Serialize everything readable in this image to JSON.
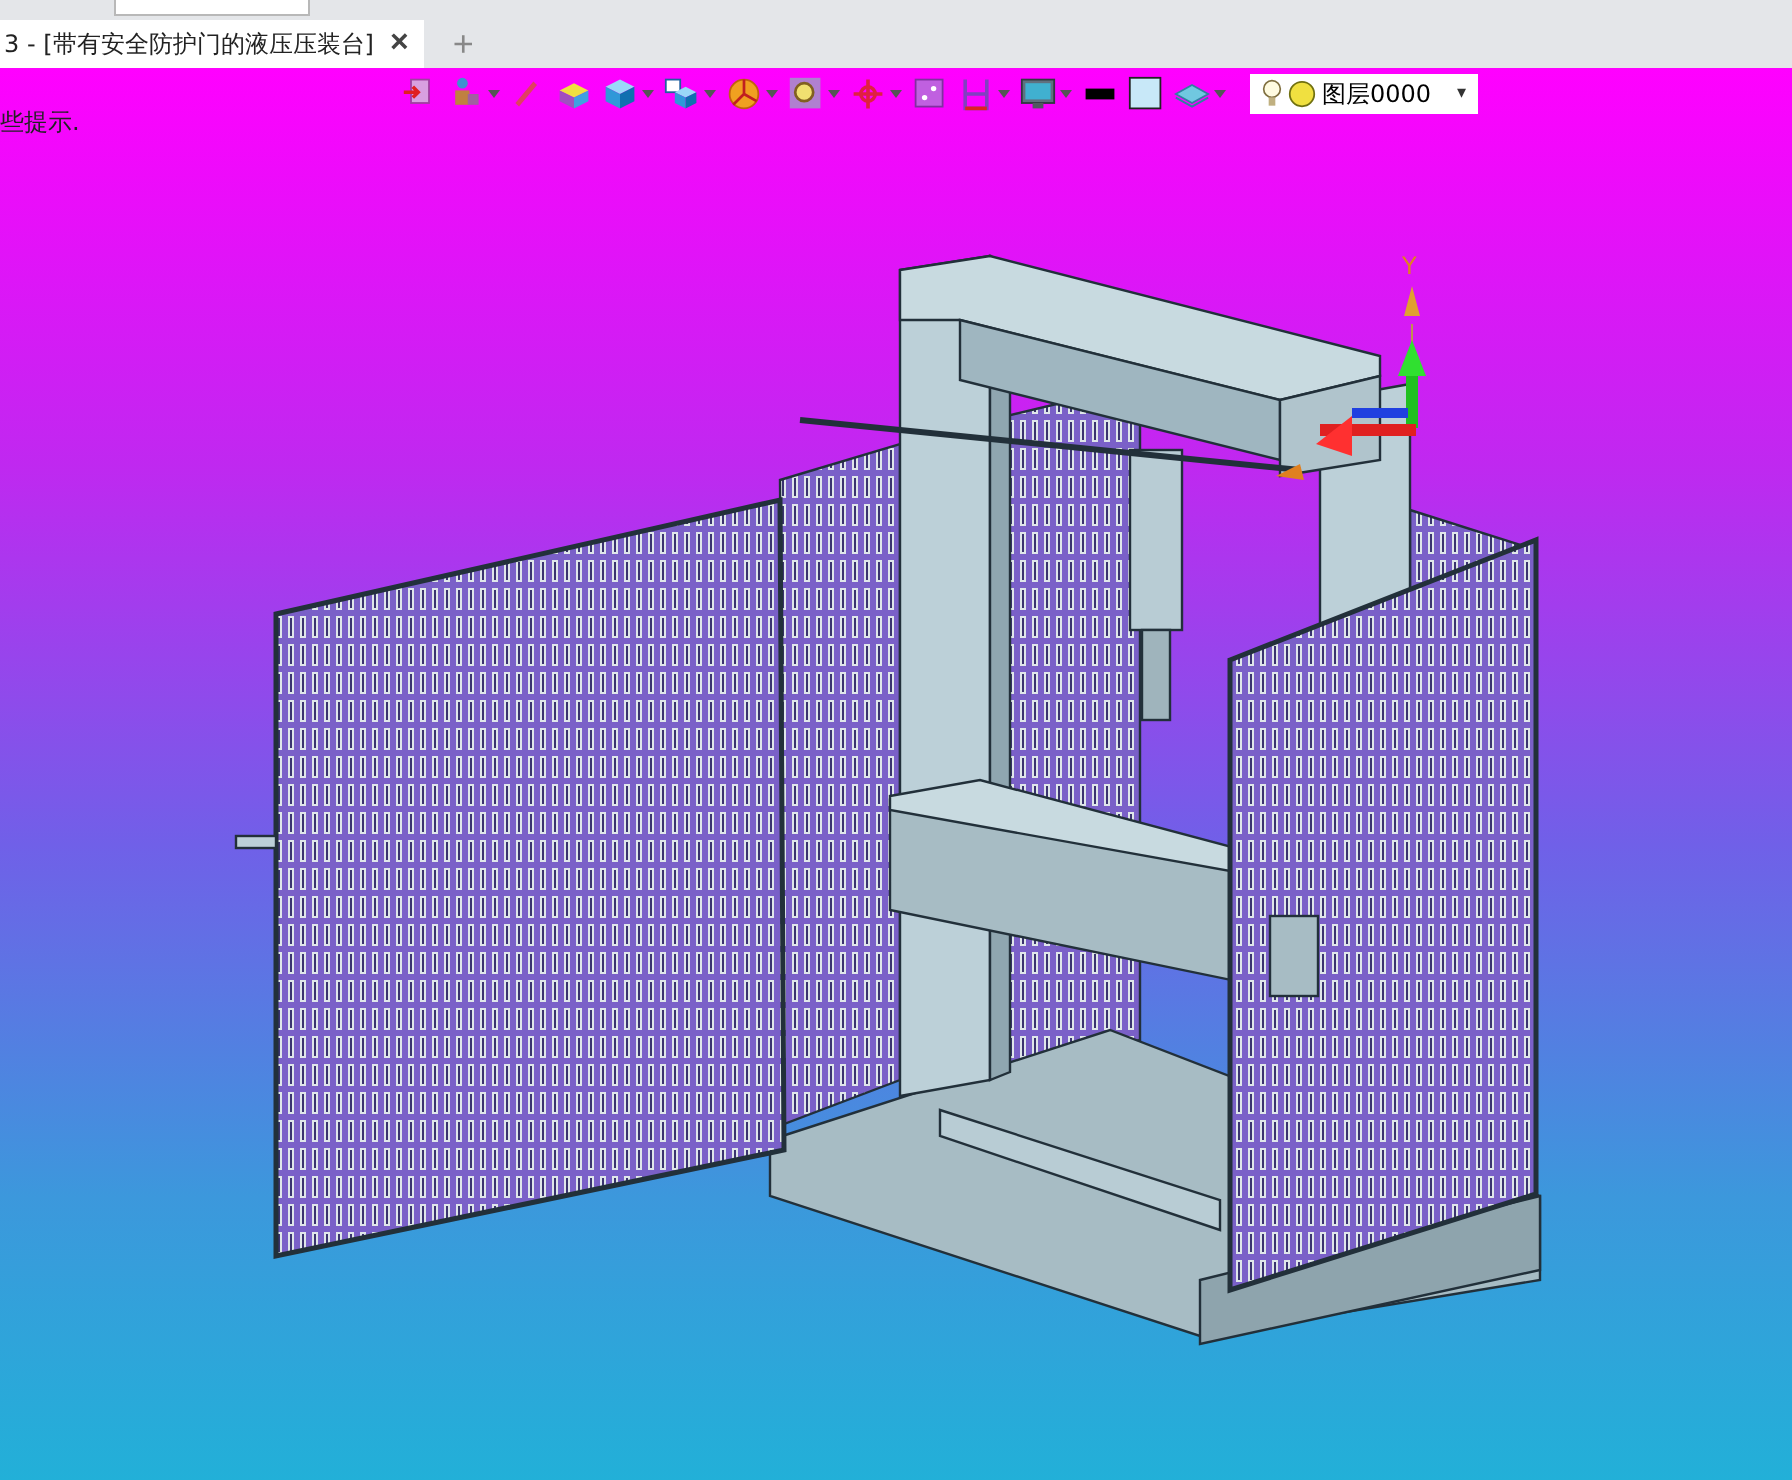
{
  "tabs": [
    {
      "label": "3 - [带有安全防护门的液压压装台]",
      "close": "×",
      "selected": true
    }
  ],
  "new_tab": "+",
  "hint": "些提示.",
  "layer_dropdown": {
    "value": "图层0000",
    "caret": "▾"
  },
  "axis": {
    "label": "Y"
  }
}
